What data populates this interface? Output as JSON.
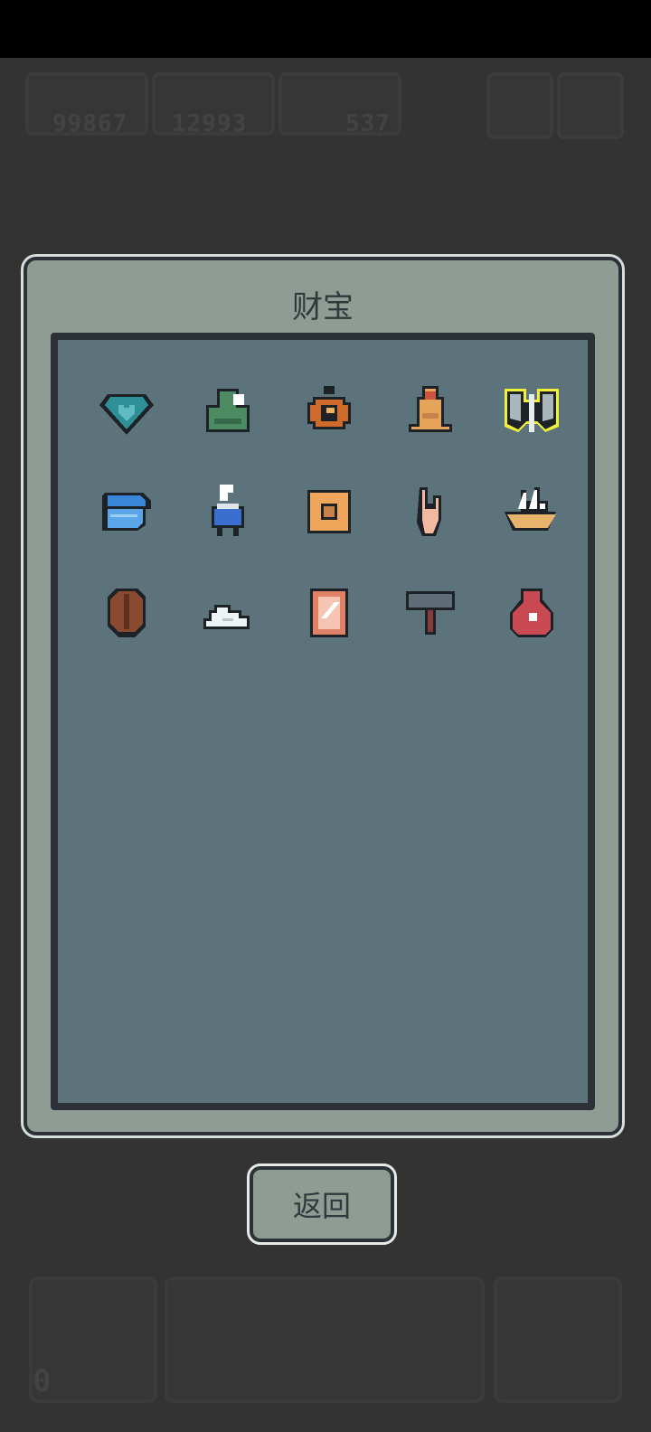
{
  "hud": {
    "coins": "99867",
    "gems": "12993",
    "followers": "537",
    "counter": "0"
  },
  "panel": {
    "title": "财宝"
  },
  "items": [
    {
      "name": "heart-gem-icon",
      "color": "#2e8f97"
    },
    {
      "name": "green-robe-icon",
      "color": "#4d8c63"
    },
    {
      "name": "pocket-watch-icon",
      "color": "#d06a2a"
    },
    {
      "name": "golden-bell-icon",
      "color": "#e6a35a"
    },
    {
      "name": "double-axe-icon",
      "color": "#f1f238"
    },
    {
      "name": "blue-hat-icon",
      "color": "#3a86d8"
    },
    {
      "name": "magic-pot-icon",
      "color": "#3a6fd0"
    },
    {
      "name": "waffle-icon",
      "color": "#f0a65a"
    },
    {
      "name": "pointing-hand-icon",
      "color": "#f3b9a0"
    },
    {
      "name": "sailing-ship-icon",
      "color": "#e8b36a"
    },
    {
      "name": "wooden-shield-icon",
      "color": "#8a4a30"
    },
    {
      "name": "cloud-icon",
      "color": "#eef4f6"
    },
    {
      "name": "scroll-icon",
      "color": "#e08268"
    },
    {
      "name": "hammer-icon",
      "color": "#5e6c77"
    },
    {
      "name": "money-bag-icon",
      "color": "#c94a52"
    }
  ],
  "buttons": {
    "back_label": "返回"
  }
}
